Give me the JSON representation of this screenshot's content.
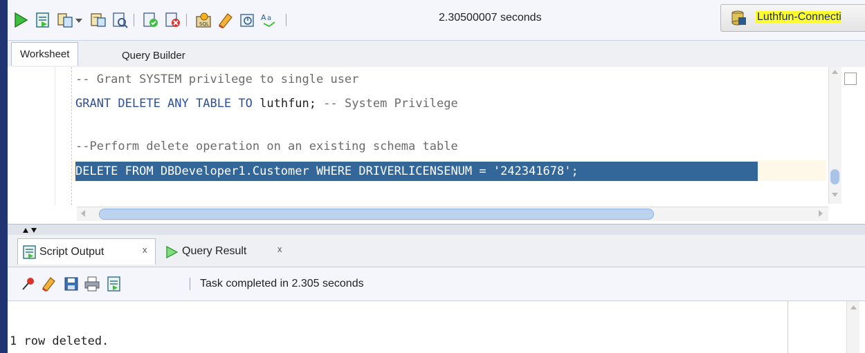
{
  "toolbar": {
    "timing": "2.30500007 seconds",
    "connection_label": "Luthfun-Connecti",
    "icons": [
      "run-icon",
      "run-script-icon",
      "autotrace-icon",
      "dropdown-icon",
      "explain-plan-icon",
      "sql-tuning-icon",
      "commit-icon",
      "rollback-icon",
      "sql-history-icon",
      "clear-icon",
      "unshared-worksheet-icon",
      "format-icon"
    ]
  },
  "worksheet_tabs": {
    "worksheet": "Worksheet",
    "query_builder": "Query Builder"
  },
  "editor": {
    "line1": "-- Grant SYSTEM privilege to single user",
    "line2_kw": "GRANT DELETE ANY TABLE TO",
    "line2_user": "luthfun;",
    "line2_comment": "-- System Privilege",
    "line4": "--Perform delete operation on an existing schema table",
    "line5": "DELETE FROM DBDeveloper1.Customer WHERE DRIVERLICENSENUM = '242341678';"
  },
  "output_tabs": {
    "script_output": "Script Output",
    "query_result": "Query Result",
    "close": "x"
  },
  "output_toolbar": {
    "status": "Task completed in 2.305 seconds"
  },
  "output": {
    "text": "1 row deleted."
  },
  "colors": {
    "accent": "#336699",
    "highlight": "#ffff2e",
    "frame": "#203474"
  }
}
